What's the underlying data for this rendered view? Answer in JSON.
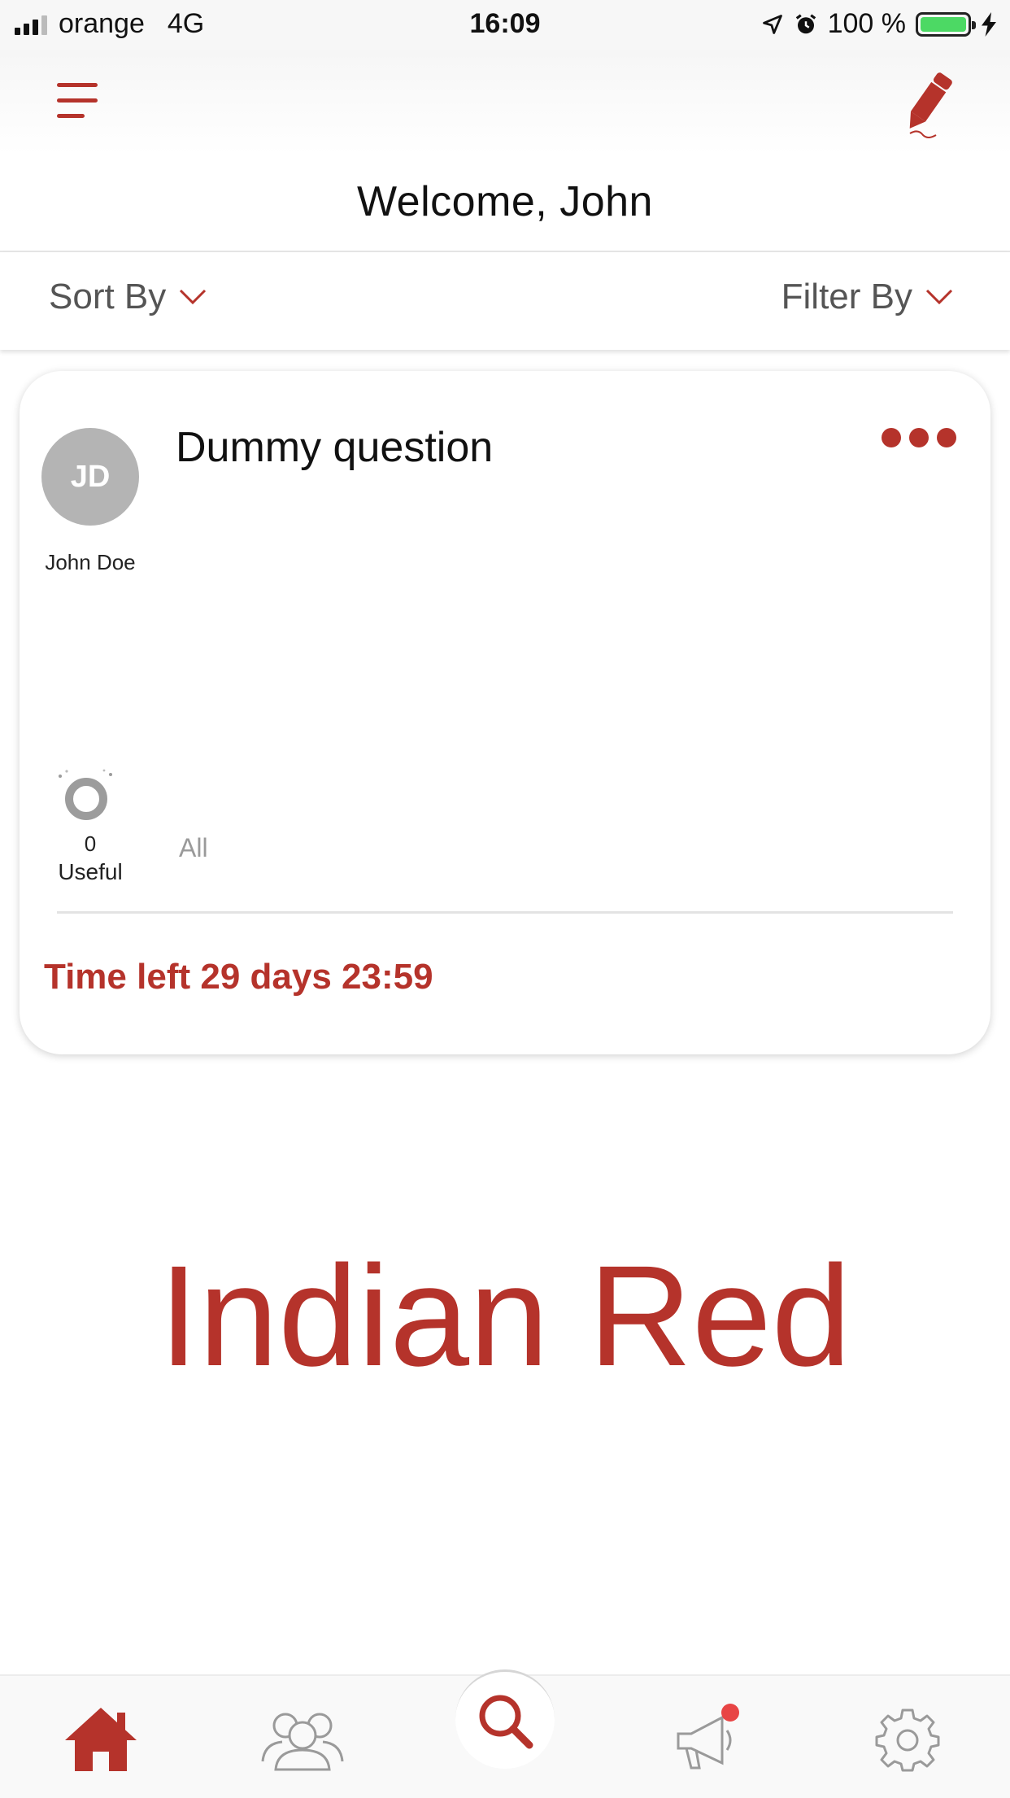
{
  "status_bar": {
    "carrier": "orange",
    "network": "4G",
    "time": "16:09",
    "battery_percent": "100 %",
    "battery_level": 1.0
  },
  "header": {
    "menu_icon": "hamburger-menu-icon",
    "compose_icon": "pencil-icon",
    "welcome_text": "Welcome, John"
  },
  "toolbar": {
    "sort_label": "Sort By",
    "filter_label": "Filter By"
  },
  "question_card": {
    "avatar_initials": "JD",
    "author_name": "John Doe",
    "title": "Dummy question",
    "more_icon": "more-dots-icon",
    "useful_count": "0",
    "useful_label": "Useful",
    "all_label": "All",
    "time_left": "Time left 29 days 23:59"
  },
  "overlay_text": "Indian Red",
  "tab_bar": {
    "items": [
      {
        "name": "home",
        "icon": "home-icon",
        "active": true
      },
      {
        "name": "community",
        "icon": "people-icon",
        "active": false
      },
      {
        "name": "search",
        "icon": "search-icon",
        "active": false
      },
      {
        "name": "announcements",
        "icon": "megaphone-icon",
        "active": false,
        "badge": true
      },
      {
        "name": "settings",
        "icon": "gear-icon",
        "active": false
      }
    ]
  },
  "colors": {
    "accent": "#b5332b",
    "battery": "#4cd964",
    "avatar_bg": "#b4b4b4"
  }
}
